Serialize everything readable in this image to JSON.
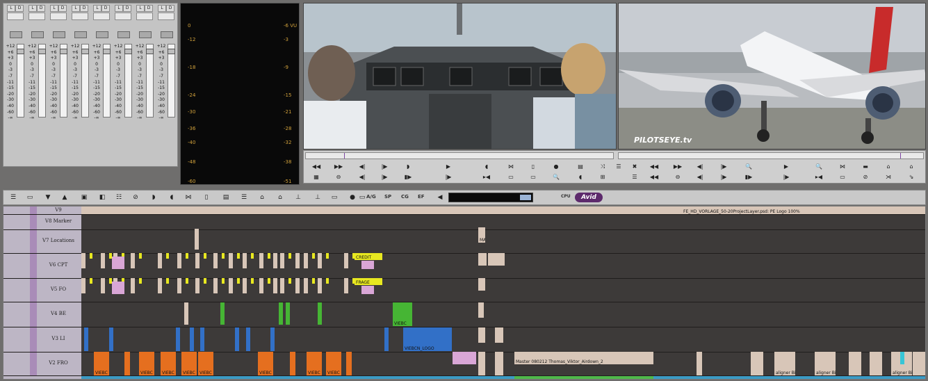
{
  "mixer": {
    "channels": [
      {
        "btn1": "L",
        "btn2": "D"
      },
      {
        "btn1": "L",
        "btn2": "D"
      },
      {
        "btn1": "L",
        "btn2": "D"
      },
      {
        "btn1": "L",
        "btn2": "D"
      },
      {
        "btn1": "L",
        "btn2": "D"
      },
      {
        "btn1": "L",
        "btn2": "D"
      },
      {
        "btn1": "L",
        "btn2": "D"
      },
      {
        "btn1": "L",
        "btn2": "D"
      }
    ],
    "scale": [
      "+12",
      "+6",
      "+3",
      "0",
      "-3",
      "-7",
      "-11",
      "-15",
      "-20",
      "-30",
      "-40",
      "-60",
      "-∞"
    ]
  },
  "meter": {
    "left_scale": [
      "0",
      "-12",
      "-18",
      "-24",
      "-30",
      "-36",
      "-40",
      "-48",
      "-60"
    ],
    "right_scale": [
      "-6 VU",
      "-3",
      "-9",
      "-15",
      "-21",
      "-28",
      "-32",
      "-38",
      "-51"
    ]
  },
  "monitors": {
    "record_watermark": "PILOTSEYE.tv"
  },
  "toolbar": {
    "text_buttons": [
      "A/G",
      "SP",
      "CG",
      "EF"
    ],
    "cpu_label": "CPU",
    "brand": "Avid"
  },
  "tracks": [
    {
      "name": "V9"
    },
    {
      "name": "V8 Marker"
    },
    {
      "name": "V7 Locations"
    },
    {
      "name": "V6 CPT"
    },
    {
      "name": "V5 FO"
    },
    {
      "name": "V4 BE"
    },
    {
      "name": "V3 LI"
    },
    {
      "name": "V2 FRO"
    }
  ],
  "clips": {
    "v9_title": "FE_HD_VORLAGE_50-20ProjectLayer.psd: PE Logo 100%",
    "v2_long": "Master 080212 Thomas_Viktor_Airdown_2",
    "viebc": "VIEBC",
    "viebc_logo": "VIEBCN_LOGO",
    "v6_label": "CREDIT",
    "v5_label": "FRAGE",
    "ma": "MA",
    "aligner": "aligner Bin"
  },
  "colors": {
    "purple_track_header": "#bdb6c5",
    "clip_orange": "#e56f1f",
    "clip_blue": "#3270c7",
    "clip_green": "#46b534",
    "clip_tan": "#d8c6b8",
    "clip_pink": "#d9a6d6",
    "clip_yellow": "#e8e820"
  }
}
